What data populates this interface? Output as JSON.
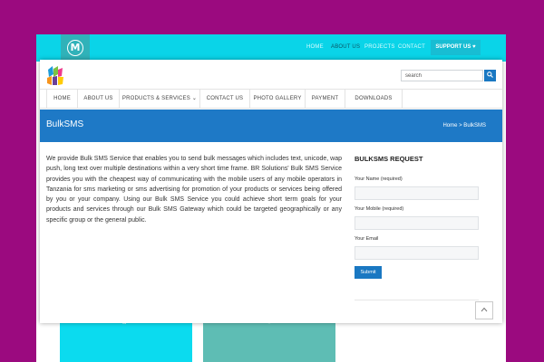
{
  "outer_site": {
    "logo_letter": "M",
    "nav": [
      {
        "label": "HOME",
        "active": false
      },
      {
        "label": "ABOUT US",
        "active": true
      },
      {
        "label": "PROJECTS",
        "active": false
      },
      {
        "label": "CONTACT",
        "active": false
      }
    ],
    "support_label": "SUPPORT US ♥",
    "card_icons": [
      "victory-hand-icon",
      "eye-icon"
    ],
    "colors": {
      "bar": "#0ad4e8",
      "card1": "#0bdbef",
      "card2": "#5ebdb4"
    }
  },
  "header": {
    "logo_icon": "br-solutions-logo",
    "search": {
      "placeholder": "search",
      "button_icon": "search-icon"
    }
  },
  "nav": {
    "items": [
      {
        "label": "HOME"
      },
      {
        "label": "ABOUT US"
      },
      {
        "label": "PRODUCTS & SERVICES ⌄"
      },
      {
        "label": "CONTACT US"
      },
      {
        "label": "PHOTO GALLERY"
      },
      {
        "label": "PAYMENT"
      },
      {
        "label": "DOWNLOADS"
      }
    ]
  },
  "banner": {
    "title": "BulkSMS",
    "breadcrumb": "Home > BulkSMS",
    "color": "#1e79c6"
  },
  "content": {
    "paragraph": "We provide Bulk SMS Service that enables you to send bulk messages which includes text, unicode, wap push, long text over multiple destinations within a very short time frame. BR Solutions' Bulk SMS Service provides you with the cheapest way of communicating with the mobile users of any mobile operators in Tanzania for sms marketing or sms advertising for promotion of your products or services being offered by you or your company. Using our Bulk SMS Service you could achieve short term goals for your products and services through our Bulk SMS Gateway which could be targeted geographically or any specific group or the general public."
  },
  "form": {
    "title": "BULKSMS REQUEST",
    "fields": [
      {
        "label": "Your Name (required)",
        "value": ""
      },
      {
        "label": "Your Mobile (required)",
        "value": ""
      },
      {
        "label": "Your Email",
        "value": ""
      }
    ],
    "submit_label": "Submit"
  },
  "scroll_top_icon": "chevron-up-icon"
}
